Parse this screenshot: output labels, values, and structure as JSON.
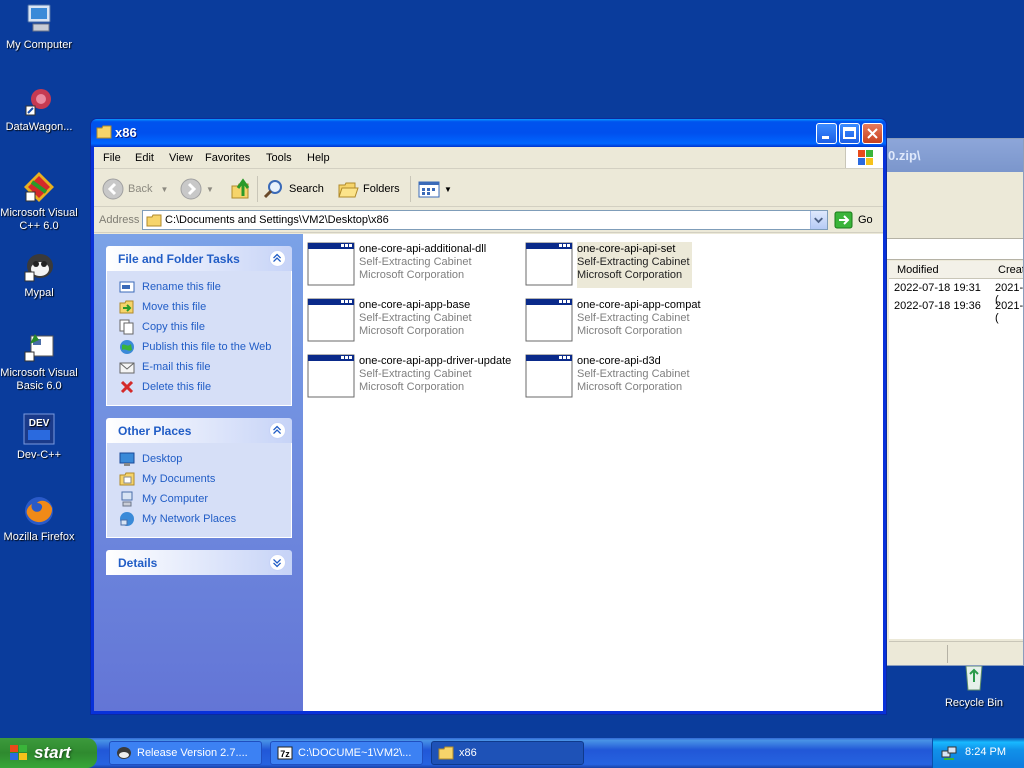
{
  "desktop": {
    "icons": [
      {
        "label": "My Computer",
        "icon": "my-computer-icon"
      },
      {
        "label": "DataWagon...",
        "icon": "datawagon-icon"
      },
      {
        "label": "Microsoft Visual C++ 6.0",
        "icon": "visual-cpp-icon"
      },
      {
        "label": "Mypal",
        "icon": "mypal-icon"
      },
      {
        "label": "Microsoft Visual Basic 6.0",
        "icon": "visual-basic-icon"
      },
      {
        "label": "Dev-C++",
        "icon": "dev-cpp-icon"
      },
      {
        "label": "Mozilla Firefox",
        "icon": "firefox-icon"
      },
      {
        "label": "Recycle Bin",
        "icon": "recycle-bin-icon"
      }
    ]
  },
  "background_window": {
    "title": "0.zip\\",
    "columns": [
      "Modified",
      "Creat"
    ],
    "rows": [
      [
        "2022-07-18 19:31",
        "2021-("
      ],
      [
        "2022-07-18 19:36",
        "2021-("
      ]
    ]
  },
  "window": {
    "title": "x86",
    "menu": [
      "File",
      "Edit",
      "View",
      "Favorites",
      "Tools",
      "Help"
    ],
    "toolbar": {
      "back": "Back",
      "search": "Search",
      "folders": "Folders"
    },
    "address": {
      "label": "Address",
      "value": "C:\\Documents and Settings\\VM2\\Desktop\\x86",
      "go": "Go"
    }
  },
  "taskpane": {
    "file_folder_tasks": {
      "title": "File and Folder Tasks",
      "items": [
        {
          "label": "Rename this file",
          "icon": "rename-icon"
        },
        {
          "label": "Move this file",
          "icon": "move-icon"
        },
        {
          "label": "Copy this file",
          "icon": "copy-icon"
        },
        {
          "label": "Publish this file to the Web",
          "icon": "publish-web-icon"
        },
        {
          "label": "E-mail this file",
          "icon": "email-icon"
        },
        {
          "label": "Delete this file",
          "icon": "delete-icon"
        }
      ]
    },
    "other_places": {
      "title": "Other Places",
      "items": [
        {
          "label": "Desktop",
          "icon": "desktop-icon"
        },
        {
          "label": "My Documents",
          "icon": "my-documents-icon"
        },
        {
          "label": "My Computer",
          "icon": "my-computer-icon"
        },
        {
          "label": "My Network Places",
          "icon": "network-places-icon"
        }
      ]
    },
    "details": {
      "title": "Details"
    }
  },
  "files": [
    {
      "name": "one-core-api-additional-dll",
      "type": "Self-Extracting Cabinet",
      "company": "Microsoft Corporation",
      "selected": false
    },
    {
      "name": "one-core-api-api-set",
      "type": "Self-Extracting Cabinet",
      "company": "Microsoft Corporation",
      "selected": true
    },
    {
      "name": "one-core-api-app-base",
      "type": "Self-Extracting Cabinet",
      "company": "Microsoft Corporation",
      "selected": false
    },
    {
      "name": "one-core-api-app-compat",
      "type": "Self-Extracting Cabinet",
      "company": "Microsoft Corporation",
      "selected": false
    },
    {
      "name": "one-core-api-app-driver-update",
      "type": "Self-Extracting Cabinet",
      "company": "Microsoft Corporation",
      "selected": false
    },
    {
      "name": "one-core-api-d3d",
      "type": "Self-Extracting Cabinet",
      "company": "Microsoft Corporation",
      "selected": false
    }
  ],
  "taskbar": {
    "start": "start",
    "tasks": [
      {
        "label": "Release Version 2.7....",
        "icon": "release-app-icon",
        "active": false
      },
      {
        "label": "C:\\DOCUME~1\\VM2\\...",
        "icon": "7zip-icon",
        "active": false
      },
      {
        "label": "x86",
        "icon": "folder-icon",
        "active": true
      }
    ],
    "clock": "8:24 PM"
  },
  "colors": {
    "desktop": "#0a3c9c",
    "titlebar": "#0053ee",
    "taskpane_link": "#215dc6",
    "start_green": "#2f8a2f"
  }
}
